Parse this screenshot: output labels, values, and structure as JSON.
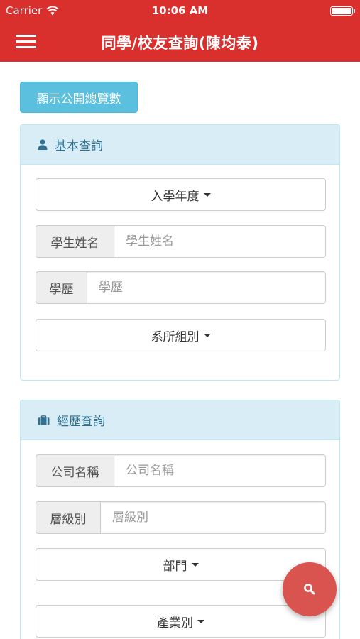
{
  "status_bar": {
    "carrier": "Carrier",
    "time": "10:06 AM",
    "wifi_icon": "wifi-icon",
    "battery_icon": "battery-icon"
  },
  "nav": {
    "title": "同學/校友查詢(陳均泰)",
    "menu_icon": "hamburger-menu-icon",
    "background": "#d9302d"
  },
  "show_total_button": {
    "label": "顯示公開總覽數",
    "color": "#5bc0de"
  },
  "basic_query": {
    "heading": "基本查詢",
    "heading_icon": "user-icon",
    "enrollment_year": {
      "label": "入學年度"
    },
    "student_name": {
      "addon": "學生姓名",
      "placeholder": "學生姓名"
    },
    "degree": {
      "addon": "學歷",
      "placeholder": "學歷"
    },
    "department": {
      "label": "系所組別"
    }
  },
  "experience_query": {
    "heading": "經歷查詢",
    "heading_icon": "briefcase-icon",
    "company_name": {
      "addon": "公司名稱",
      "placeholder": "公司名稱"
    },
    "level": {
      "addon": "層級別",
      "placeholder": "層級別"
    },
    "division": {
      "label": "部門"
    },
    "industry": {
      "label": "產業別"
    }
  },
  "search_fab": {
    "icon": "search-icon",
    "color": "#d9534f"
  }
}
